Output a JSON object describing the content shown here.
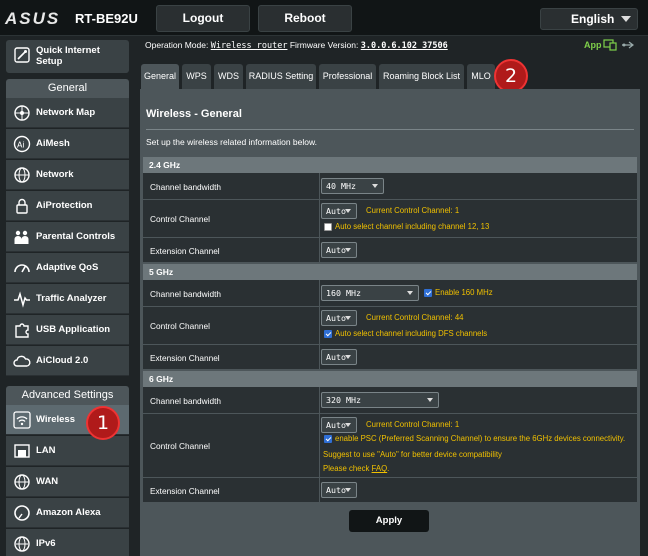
{
  "header": {
    "logo": "ASUS",
    "model": "RT-BE92U",
    "logout_label": "Logout",
    "reboot_label": "Reboot",
    "language": "English"
  },
  "sidebar": {
    "quick_setup": "Quick Internet Setup",
    "general_header": "General",
    "general_items": [
      {
        "label": "Network Map",
        "icon": "network-map-icon"
      },
      {
        "label": "AiMesh",
        "icon": "aimesh-icon"
      },
      {
        "label": "Network",
        "icon": "globe-icon"
      },
      {
        "label": "AiProtection",
        "icon": "lock-icon"
      },
      {
        "label": "Parental Controls",
        "icon": "family-icon"
      },
      {
        "label": "Adaptive QoS",
        "icon": "gauge-icon"
      },
      {
        "label": "Traffic Analyzer",
        "icon": "pulse-icon"
      },
      {
        "label": "USB Application",
        "icon": "puzzle-icon"
      },
      {
        "label": "AiCloud 2.0",
        "icon": "cloud-icon"
      }
    ],
    "advanced_header": "Advanced Settings",
    "advanced_items": [
      {
        "label": "Wireless",
        "icon": "wifi-icon",
        "active": true
      },
      {
        "label": "LAN",
        "icon": "home-icon"
      },
      {
        "label": "WAN",
        "icon": "globe-icon"
      },
      {
        "label": "Amazon Alexa",
        "icon": "alexa-icon"
      },
      {
        "label": "IPv6",
        "icon": "ipv6-icon"
      }
    ]
  },
  "status": {
    "op_mode_label": "Operation Mode:",
    "op_mode_value": "Wireless router",
    "fw_label": "Firmware Version:",
    "fw_value": "3.0.0.6.102_37506",
    "app_label": "App"
  },
  "tabs": [
    "General",
    "WPS",
    "WDS",
    "RADIUS Setting",
    "Professional",
    "Roaming Block List",
    "MLO"
  ],
  "panel": {
    "title": "Wireless - General",
    "description": "Set up the wireless related information below.",
    "band_24": {
      "header": "2.4 GHz",
      "bw_label": "Channel bandwidth",
      "bw_value": "40 MHz",
      "cc_label": "Control Channel",
      "cc_value": "Auto",
      "cc_current": "Current Control Channel: 1",
      "cc_auto_label": "Auto select channel including channel 12, 13",
      "ext_label": "Extension Channel",
      "ext_value": "Auto"
    },
    "band_5": {
      "header": "5 GHz",
      "bw_label": "Channel bandwidth",
      "bw_value": "160 MHz",
      "bw_enable_label": "Enable 160 MHz",
      "cc_label": "Control Channel",
      "cc_value": "Auto",
      "cc_current": "Current Control Channel: 44",
      "cc_auto_label": "Auto select channel including DFS channels",
      "ext_label": "Extension Channel",
      "ext_value": "Auto"
    },
    "band_6": {
      "header": "6 GHz",
      "bw_label": "Channel bandwidth",
      "bw_value": "320 MHz",
      "cc_label": "Control Channel",
      "cc_value": "Auto",
      "cc_current": "Current Control Channel: 1",
      "psc_label": "enable PSC (Preferred Scanning Channel) to ensure the 6GHz devices connectivity.",
      "suggest": "Suggest to use \"Auto\" for better device compatibility",
      "faq_prefix": "Please check ",
      "faq_link": "FAQ",
      "faq_suffix": ".",
      "ext_label": "Extension Channel",
      "ext_value": "Auto"
    },
    "apply_label": "Apply"
  },
  "callouts": {
    "one": "1",
    "two": "2"
  },
  "colors": {
    "accent_yellow": "#f0c000",
    "badge_red": "#b01a1a",
    "app_green": "#7fd14a"
  }
}
